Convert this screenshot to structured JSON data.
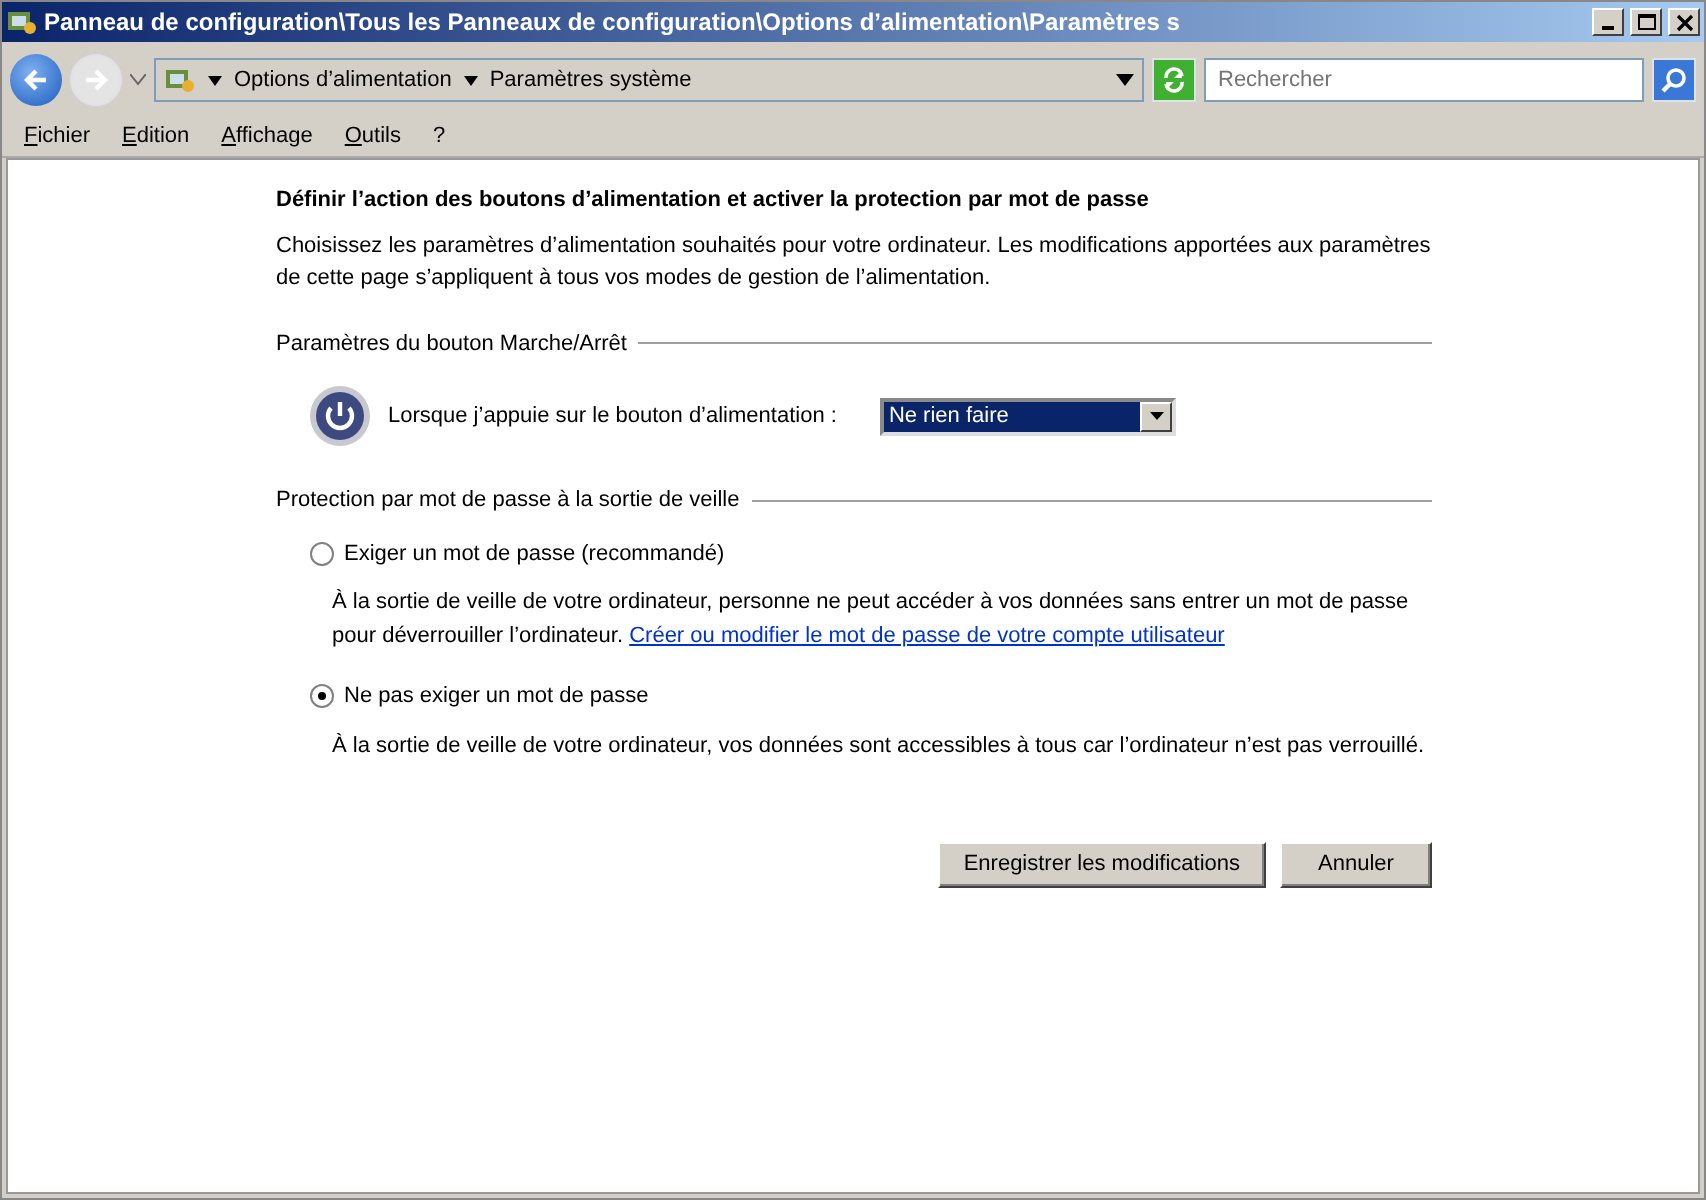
{
  "window": {
    "title": "Panneau de configuration\\Tous les Panneaux de configuration\\Options d’alimentation\\Paramètres s"
  },
  "address_bar": {
    "breadcrumbs": [
      "Options d’alimentation",
      "Paramètres système"
    ],
    "search": {
      "placeholder": "Rechercher"
    }
  },
  "menu": [
    "Fichier",
    "Edition",
    "Affichage",
    "Outils",
    "?"
  ],
  "heading": "Définir l’action des boutons d’alimentation et activer la protection par mot de passe",
  "intro": "Choisissez les paramètres d’alimentation souhaités pour votre ordinateur. Les modifications apportées aux paramètres de cette page s’appliquent à tous vos modes de gestion de l’alimentation.",
  "power_section": {
    "title": "Paramètres du bouton Marche/Arrêt",
    "label": "Lorsque j’appuie sur le bouton d’alimentation :",
    "value": "Ne rien faire"
  },
  "password_section": {
    "title": "Protection par mot de passe à la sortie de veille",
    "options": [
      {
        "label": "Exiger un mot de passe (recommandé)",
        "selected": false,
        "description": "À la sortie de veille de votre ordinateur, personne ne peut accéder à vos données sans entrer un mot de passe pour déverrouiller l’ordinateur.",
        "link": "Créer ou modifier le mot de passe de votre compte utilisateur"
      },
      {
        "label": "Ne pas exiger un mot de passe",
        "selected": true,
        "description": "À la sortie de veille de votre ordinateur, vos données sont accessibles à tous car l’ordinateur n’est pas verrouillé."
      }
    ]
  },
  "buttons": [
    "Enregistrer les modifications",
    "Annuler"
  ]
}
